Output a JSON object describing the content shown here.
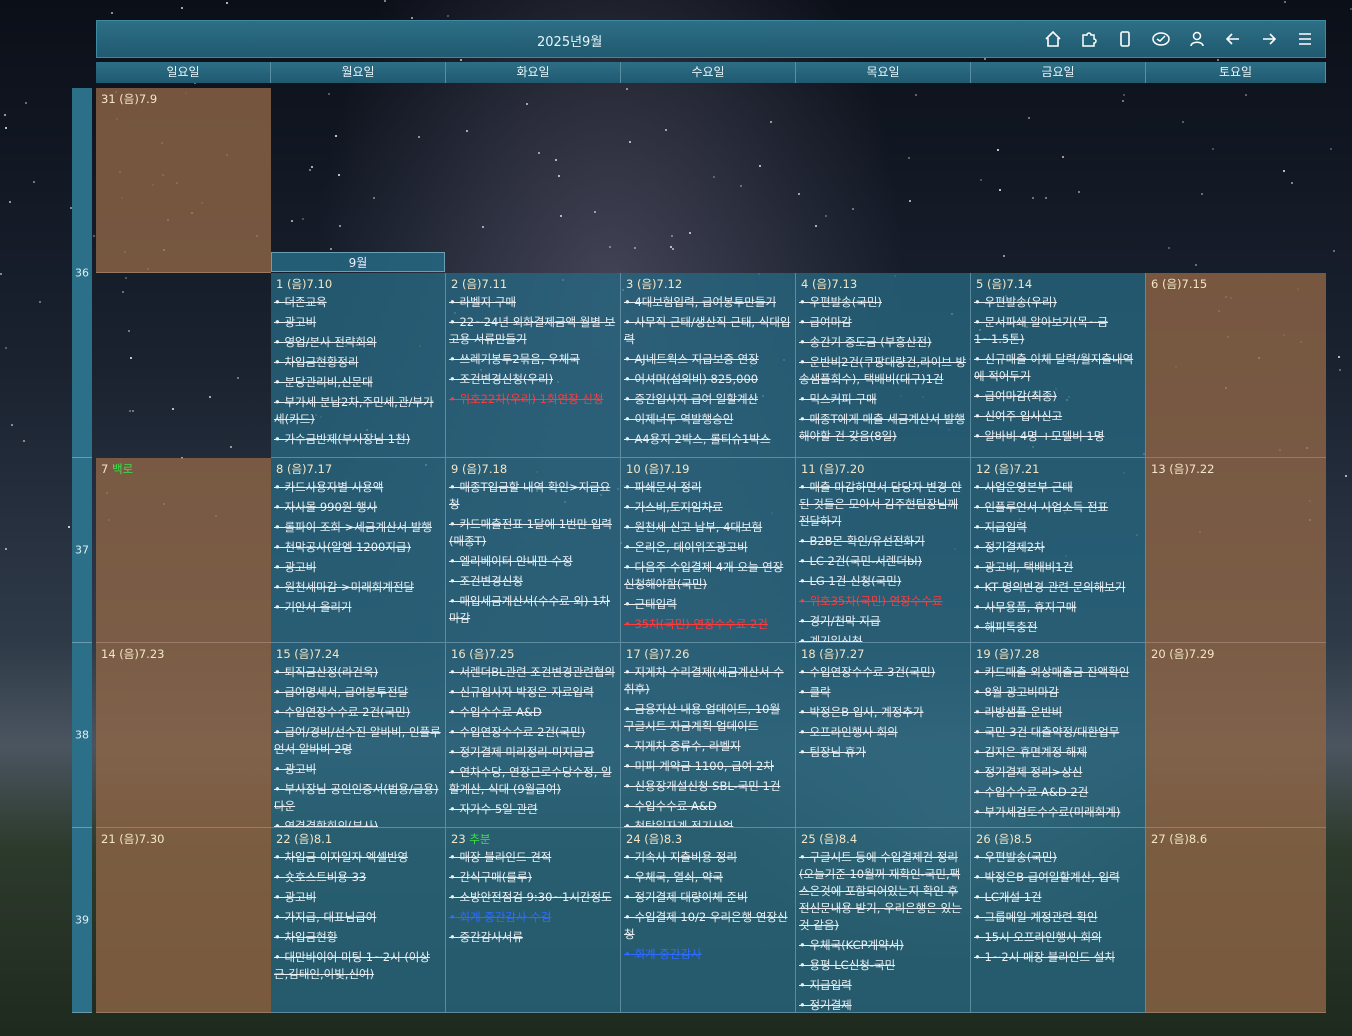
{
  "header": {
    "title": "2025년9월",
    "icons": [
      "home-icon",
      "puzzle-icon",
      "phone-icon",
      "cloud-check-icon",
      "user-icon",
      "arrow-left-icon",
      "arrow-right-icon",
      "menu-icon"
    ]
  },
  "days": [
    "일요일",
    "월요일",
    "화요일",
    "수요일",
    "목요일",
    "금요일",
    "토요일"
  ],
  "month_label": "9월",
  "weeks": [
    {
      "num": "36",
      "cells": [
        {
          "date": "31 (음)7.9",
          "items": []
        },
        {
          "date": "1 (음)7.10",
          "items": [
            "더존교육",
            "광고비",
            "영업/본사 전략회의",
            "차입금현황정리",
            "분당관리비,신문대",
            "부가세 분납2차,주민세,관/부가세(카드)",
            "가수금반제(부사장님 1천)"
          ]
        },
        {
          "date": "2 (음)7.11",
          "items": [
            "라벨지 구매",
            "22~24년 외화결제금액 월별 보고용 서류만들기",
            "쓰레기봉투2묶음, 우체국",
            "조건변경신청(우리)",
            "위호22차(우리) 1회연장 신청"
          ]
        },
        {
          "date": "3 (음)7.12",
          "items": [
            "4대보험입력, 급여봉투만들기",
            "사무직 근태/생산직 근태, 식대입력",
            "AJ네트웍스 지급보증 연장",
            "어셔머(섭외비) 825,000",
            "중간입사자 급여 일할계산",
            "이제너두 역발행승인",
            "A4용지 2박스, 롤티슈1박스"
          ]
        },
        {
          "date": "4 (음)7.13",
          "items": [
            "우편발송(국민)",
            "급여마감",
            "송간기 중도금 (부흥산전)",
            "운반비2건(쿠팡대량건,라이브 방송샘플회수), 택배비(대구)1건",
            "믹스커피 구매",
            "매종T에게 매출 세금계산서 발행해야할 건 갖음(8일)"
          ]
        },
        {
          "date": "5 (음)7.14",
          "items": [
            "우편발송(우리)",
            "문서파쇄 알아보기(목~금 1~1.5톤)",
            "신규매출 이체 달력/월지출내역에 적어두기",
            "급여마감(최종)",
            "신여주 입사신고",
            "알바비 4명 +모델비 1명"
          ]
        },
        {
          "date": "6 (음)7.15",
          "items": []
        }
      ]
    },
    {
      "num": "37",
      "cells": [
        {
          "date": "7",
          "hol": "백로",
          "items": []
        },
        {
          "date": "8 (음)7.17",
          "items": [
            "카드사용자별 사용액",
            "자사몰 990원 행사",
            "롤파이 조회 >세금계산서 발행",
            "천막공사(알엠 1200지급)",
            "광고비",
            "원천세마감 >미래회계전달",
            "기안서 올리기"
          ]
        },
        {
          "date": "9 (음)7.18",
          "items": [
            "매종T입금할 내역 확인>지급요청",
            "카드매출전표 1달에 1번만 입력 (매종T)",
            "엘리베이터 안내판 수정",
            "조건변경신청",
            "매입세금계산서(수수료 외) 1차 마감"
          ]
        },
        {
          "date": "10 (음)7.19",
          "items": [
            "파쇄문서 정리",
            "가스비,토지임차료",
            "원천세 신고 납부, 4대보험",
            "온리온, 데이위즈광고비",
            "다음주 수입결제 4개 오늘 연장신청해야함(국민)",
            "근태입력",
            "35차(국민) 연장수수료 2건"
          ]
        },
        {
          "date": "11 (음)7.20",
          "items": [
            "매출 마감하면서 담당자 변경 안된 것들은 모아서 김주현팀장님께 전달하기",
            "B2B몬 확인/유선전화기",
            "LC 2건(국민-서렌더bl)",
            "LG 1건 신청(국민)",
            "위호35차(국민) 연장수수료",
            "경기/천막 지급",
            "계기일신청"
          ]
        },
        {
          "date": "12 (음)7.21",
          "items": [
            "사업운영본부 근태",
            "인플루언서 사업소득 전표",
            "지급입력",
            "정기결제2차",
            "광고비, 택배비1건",
            "KT 명의변경 관련 문의해보기",
            "사무용품, 휴지구매",
            "해피톡충전"
          ]
        },
        {
          "date": "13 (음)7.22",
          "items": []
        }
      ]
    },
    {
      "num": "38",
      "cells": [
        {
          "date": "14 (음)7.23",
          "items": []
        },
        {
          "date": "15 (음)7.24",
          "items": [
            "퇴직금산정(라건욱)",
            "급여명세서, 급여봉투전달",
            "수입연장수수료 2건(국민)",
            "급여/경비/선수진 알바비, 인플루언서 알바비 2명",
            "광고비",
            "부사장님 공인인증서(법용/급용)다운",
            "연결결합회의(부사)"
          ]
        },
        {
          "date": "16 (음)7.25",
          "items": [
            "서렌더BL관련 조건변경관련협의",
            "신규입사자 박정은 자료입력",
            "수입수수료 A&D",
            "수입연장수수료 2건(국민)",
            "정기결제 미리정리-미지급금",
            "연차수당, 연장근로수당수정, 일할계산, 식대 (9월급여)",
            "자가수 5일 관련"
          ]
        },
        {
          "date": "17 (음)7.26",
          "items": [
            "지게차 수리결제(세금계산서 수취후)",
            "금융자산 내용 업데이트, 10월 구글시트 자금계획 업데이트",
            "지게차 증류수, 라벨지",
            "미피 계약금 1100, 급여 2차",
            "신용장개설신청 SBL-국민 1건",
            "수입수수료 A&D",
            "청탁일자계 전기사업"
          ]
        },
        {
          "date": "18 (음)7.27",
          "items": [
            "수입연장수수료 3건(국민)",
            "클락",
            "박정은B 입사, 계정추가",
            "오프라인행사 회의",
            "팀장님 휴가"
          ]
        },
        {
          "date": "19 (음)7.28",
          "items": [
            "카드매출 외상매출금 잔액확인",
            "8월 광고비마감",
            "라방샘플 운반비",
            "국민 3건 대출약정/대환업무",
            "김지은 휴면계정 해제",
            "정기결제 정리>상신",
            "수입수수료 A&D 2건",
            "부가세검토수수료(미래회계)"
          ]
        },
        {
          "date": "20 (음)7.29",
          "items": []
        }
      ]
    },
    {
      "num": "39",
      "cells": [
        {
          "date": "21 (음)7.30",
          "items": []
        },
        {
          "date": "22 (음)8.1",
          "items": [
            "차입금 이자일자 엑셀반영",
            "숏호스트비용 33",
            "광고비",
            "가지급, 대표님급여",
            "차입금현황",
            "대만바이어 미팅 1~2시 (이상근,김태인,이빛,신여)"
          ]
        },
        {
          "date": "23",
          "hol": "추분",
          "items": [
            "매장 블라인드 견적",
            "간식구매(룰루)",
            "소방안전점검 9:30~1시간정도",
            "회계 중간감사 수검",
            "중간감사서류"
          ]
        },
        {
          "date": "24 (음)8.3",
          "items": [
            "기속사 지출비용 정리",
            "우체국, 열쇠, 약국",
            "정기결제 대량이체 준비",
            "수입결제 10/2 우리은행 연장신청",
            "회계 중간감사"
          ]
        },
        {
          "date": "25 (음)8.4",
          "items": [
            "구글시트 등에 수입결제건 정리(오늘기준 10월꺼 재확인-국민,팩스온것에 포함되어있는지 확인 후 전신문내용 받기, 우리은행은 있는 것 같음)",
            "우체국(KCP계약서)",
            "용평 LC신청-국민",
            "지급입력",
            "정기결제"
          ]
        },
        {
          "date": "26 (음)8.5",
          "items": [
            "우편발송(국민)",
            "박정은B 급여일할계산, 입력",
            "LC개설 1건",
            "그룹메일 계정관련 확인",
            "15시 오프라인행사 회의",
            "1~2시 매장 블라인드 설치"
          ]
        },
        {
          "date": "27 (음)8.6",
          "items": []
        }
      ]
    }
  ]
}
